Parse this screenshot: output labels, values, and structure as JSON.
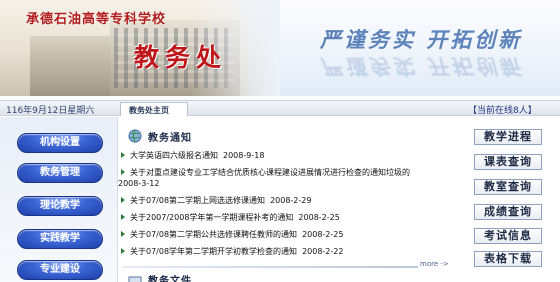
{
  "header": {
    "school_name": "承德石油高等专科学校",
    "dept_name": "教务处",
    "motto": "严谨务实 开拓创新"
  },
  "navstrip": {
    "date": "116年9月12日星期六",
    "breadcrumb": "教务处主页",
    "online": "【当前在线8人】"
  },
  "sidebar": {
    "items": [
      {
        "label": "机构设置"
      },
      {
        "label": "教务管理"
      },
      {
        "label": "理论教学"
      },
      {
        "label": "实践教学"
      },
      {
        "label": "专业建设"
      }
    ]
  },
  "notices": {
    "title": "教务通知",
    "items": [
      {
        "text": "大学英语四六级报名通知",
        "date": "2008-9-18"
      },
      {
        "text": "关于对重点建设专业工学结合优质核心课程建设进展情况进行检查的通知垃圾的",
        "date": "2008-3-12"
      },
      {
        "text": "关于07/08第二学期上网选选修课通知",
        "date": "2008-2-29"
      },
      {
        "text": "关于2007/2008学年第一学期课程补考的通知",
        "date": "2008-2-25"
      },
      {
        "text": "关于07/08第二学期公共选修课聘任教师的通知",
        "date": "2008-2-25"
      },
      {
        "text": "关于07/08学年第二学期开学初教学检查的通知",
        "date": "2008-2-22"
      }
    ],
    "more": "more ->"
  },
  "files": {
    "title": "教务文件"
  },
  "quick_links": {
    "items": [
      {
        "label": "教学进程"
      },
      {
        "label": "课表查询"
      },
      {
        "label": "教室查询"
      },
      {
        "label": "成绩查询"
      },
      {
        "label": "考试信息"
      },
      {
        "label": "表格下载"
      }
    ]
  },
  "colors": {
    "dept_red": "#c0161a",
    "motto_blue": "#5c84ba",
    "menu_blue": "#2b4fc0",
    "bullet_green": "#2a7a3a"
  },
  "icons": {
    "section": "globe-icon",
    "bullet": "arrow-right-icon"
  }
}
